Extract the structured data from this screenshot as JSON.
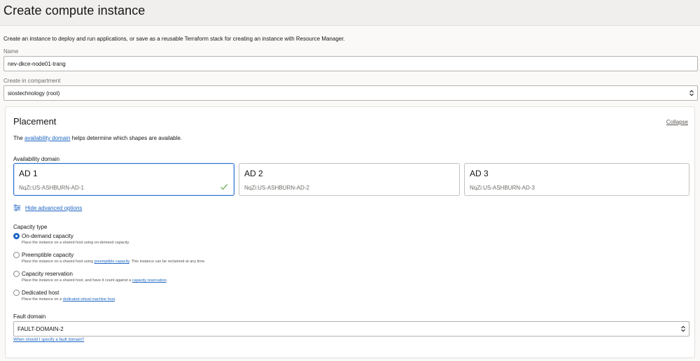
{
  "header": {
    "title": "Create compute instance"
  },
  "intro": "Create an instance to deploy and run applications, or save as a reusable Terraform stack for creating an instance with Resource Manager.",
  "name_field": {
    "label": "Name",
    "value": "nev-dkce-node01-trang"
  },
  "compartment_field": {
    "label": "Create in compartment",
    "value": "siostechnology (root)"
  },
  "placement": {
    "title": "Placement",
    "collapse_label": "Collapse",
    "help_prefix": "The",
    "help_link": "availability domain",
    "help_suffix": "helps determine which shapes are available.",
    "ad_label": "Availability domain",
    "ads": [
      {
        "name": "AD 1",
        "sub": "NqZi:US-ASHBURN-AD-1",
        "selected": true
      },
      {
        "name": "AD 2",
        "sub": "NqZi:US-ASHBURN-AD-2",
        "selected": false
      },
      {
        "name": "AD 3",
        "sub": "NqZi:US-ASHBURN-AD-3",
        "selected": false
      }
    ],
    "advanced_link": "Hide advanced options",
    "capacity_label": "Capacity type",
    "capacity_options": [
      {
        "title": "On-demand capacity",
        "desc": "Place the instance on a shared host using on-demand capacity.",
        "selected": true
      },
      {
        "title": "Preemptible capacity",
        "desc_prefix": "Place the instance on a shared host using",
        "desc_link": "preemptible capacity",
        "desc_suffix": ". This instance can be reclaimed at any time.",
        "selected": false
      },
      {
        "title": "Capacity reservation",
        "desc_prefix": "Place the instance on a shared host, and have it count against a",
        "desc_link": "capacity reservation",
        "desc_suffix": ".",
        "selected": false
      },
      {
        "title": "Dedicated host",
        "desc_prefix": "Place the instance on a",
        "desc_link": "dedicated virtual machine host",
        "desc_suffix": ".",
        "selected": false
      }
    ],
    "fault_domain_label": "Fault domain",
    "fault_domain_value": "FAULT-DOMAIN-2",
    "fault_domain_help": "When should I specify a fault domain?"
  },
  "colors": {
    "accent": "#1e66c2",
    "selected_border": "#2a6fd0",
    "check": "#4c9f38"
  },
  "icons": {
    "check": "checkmark-icon",
    "advanced": "sliders-icon",
    "select": "select-arrows-icon"
  }
}
